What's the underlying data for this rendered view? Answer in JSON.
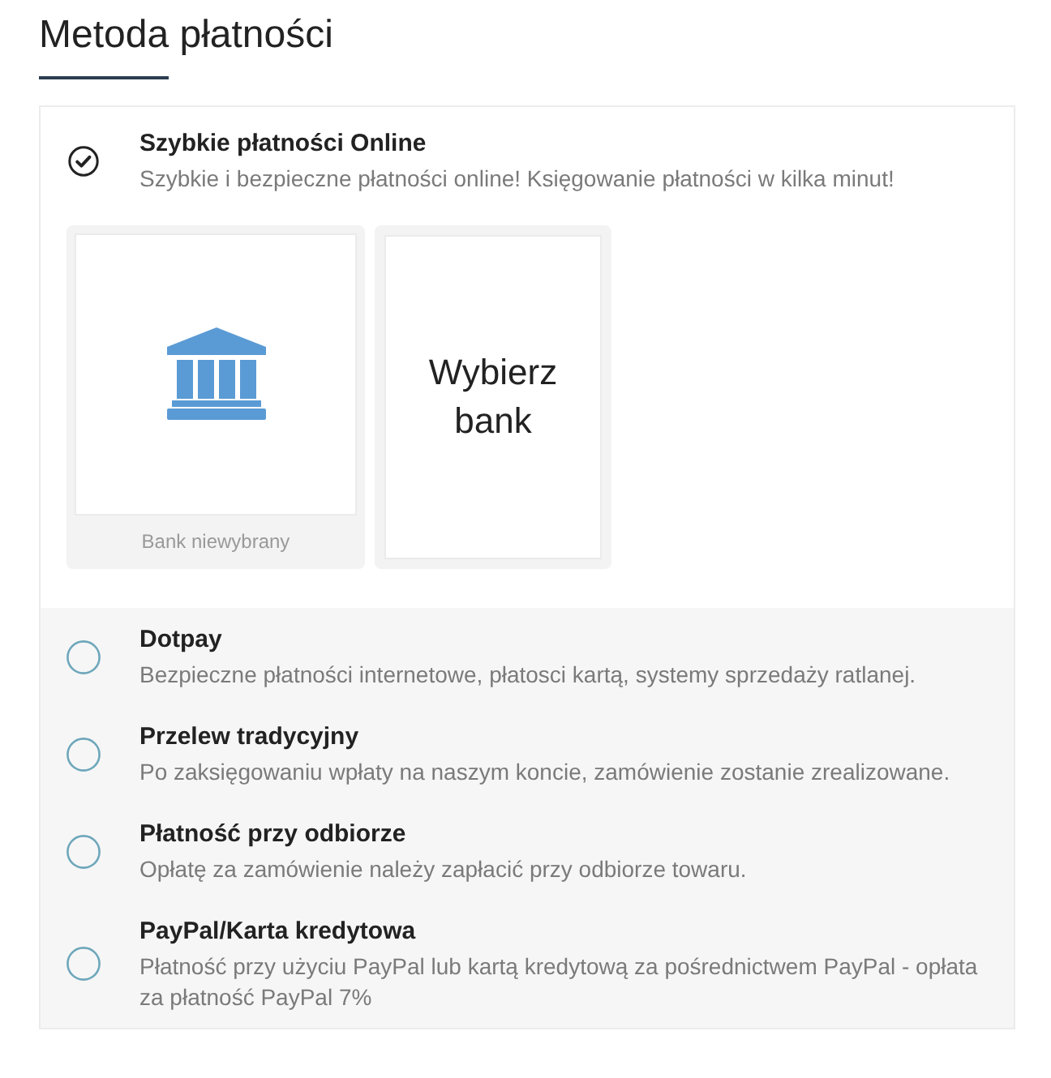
{
  "heading": "Metoda płatności",
  "methods": [
    {
      "name": "Szybkie płatności Online",
      "description": "Szybkie i bezpieczne płatności online! Księgowanie płatności w kilka minut!",
      "selected": true,
      "bank_tiles": [
        {
          "kind": "bank",
          "caption": "Bank niewybrany"
        },
        {
          "kind": "choose",
          "label": "Wybierz bank"
        }
      ]
    },
    {
      "name": "Dotpay",
      "description": "Bezpieczne płatności internetowe, płatosci kartą, systemy sprzedaży ratlanej.",
      "selected": false
    },
    {
      "name": "Przelew tradycyjny",
      "description": "Po zaksięgowaniu wpłaty na naszym koncie, zamówienie zostanie zrealizowane.",
      "selected": false
    },
    {
      "name": "Płatność przy odbiorze",
      "description": "Opłatę za zamówienie należy zapłacić przy odbiorze towaru.",
      "selected": false
    },
    {
      "name": "PayPal/Karta kredytowa",
      "description": "Płatność przy użyciu PayPal lub kartą kredytową za pośrednictwem PayPal - opłata za płatność PayPal 7%",
      "selected": false
    }
  ]
}
